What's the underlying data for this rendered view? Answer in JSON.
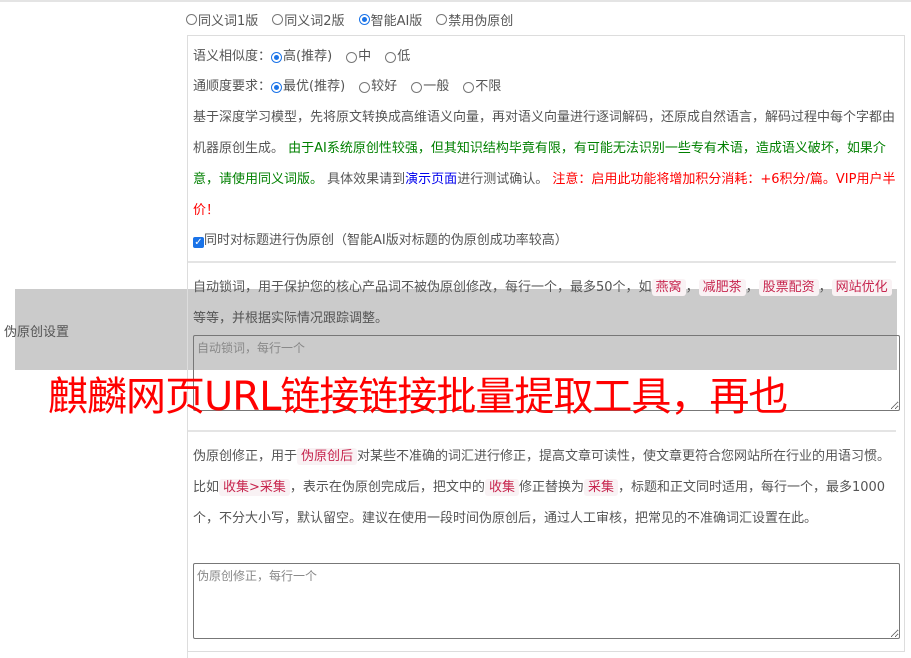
{
  "side_label": "伪原创设置",
  "mode_options": [
    {
      "label": "同义词1版",
      "checked": false
    },
    {
      "label": "同义词2版",
      "checked": false
    },
    {
      "label": "智能AI版",
      "checked": true
    },
    {
      "label": "禁用伪原创",
      "checked": false
    }
  ],
  "similarity": {
    "label": "语义相似度：",
    "options": [
      {
        "label": "高(推荐)",
        "checked": true
      },
      {
        "label": "中",
        "checked": false
      },
      {
        "label": "低",
        "checked": false
      }
    ]
  },
  "fluency": {
    "label": "通顺度要求：",
    "options": [
      {
        "label": "最优(推荐)",
        "checked": true
      },
      {
        "label": "较好",
        "checked": false
      },
      {
        "label": "一般",
        "checked": false
      },
      {
        "label": "不限",
        "checked": false
      }
    ]
  },
  "description": {
    "intro": "基于深度学习模型，先将原文转换成高维语义向量，再对语义向量进行逐词解码，还原成自然语言，解码过程中每个字都由机器原创生成。",
    "green_note": "由于AI系统原创性较强，但其知识结构毕竟有限，有可能无法识别一些专有术语，造成语义破坏，如果介意，请使用同义词版。",
    "demo_prefix": "具体效果请到",
    "demo_link": "演示页面",
    "demo_suffix": "进行测试确认。",
    "red_note": "注意：启用此功能将增加积分消耗：+6积分/篇。VIP用户半价！"
  },
  "title_checkbox": {
    "label": "同时对标题进行伪原创（智能AI版对标题的伪原创成功率较高）",
    "checked": true
  },
  "lock_words": {
    "text_1": "自动锁词，用于保护您的核心产品词不被伪原创修改，每行一个，最多50个，如",
    "examples": [
      "燕窝",
      "减肥茶",
      "股票配资",
      "网站优化"
    ],
    "text_2": "等等，并根据实际情况跟踪调整。",
    "placeholder": "自动锁词，每行一个"
  },
  "correction": {
    "text_1": "伪原创修正，用于",
    "code_1": "伪原创后",
    "text_2": "对某些不准确的词汇进行修正，提高文章可读性，使文章更符合您网站所在行业的用语习惯。比如",
    "code_2": "收集>采集",
    "text_3": "，表示在伪原创完成后，把文中的",
    "code_3": "收集",
    "text_4": "修正替换为",
    "code_4": "采集",
    "text_5": "，标题和正文同时适用，每行一个，最多1000个，不分大小写，默认留空。建议在使用一段时间伪原创后，通过人工审核，把常见的不准确词汇设置在此。",
    "placeholder": "伪原创修正，每行一个"
  },
  "banner": "麒麟网页URL链接链接批量提取工具，再也",
  "colors": {
    "accent": "#1a73e8",
    "green": "#008000",
    "red": "#ff0000",
    "code": "#c7254e"
  }
}
